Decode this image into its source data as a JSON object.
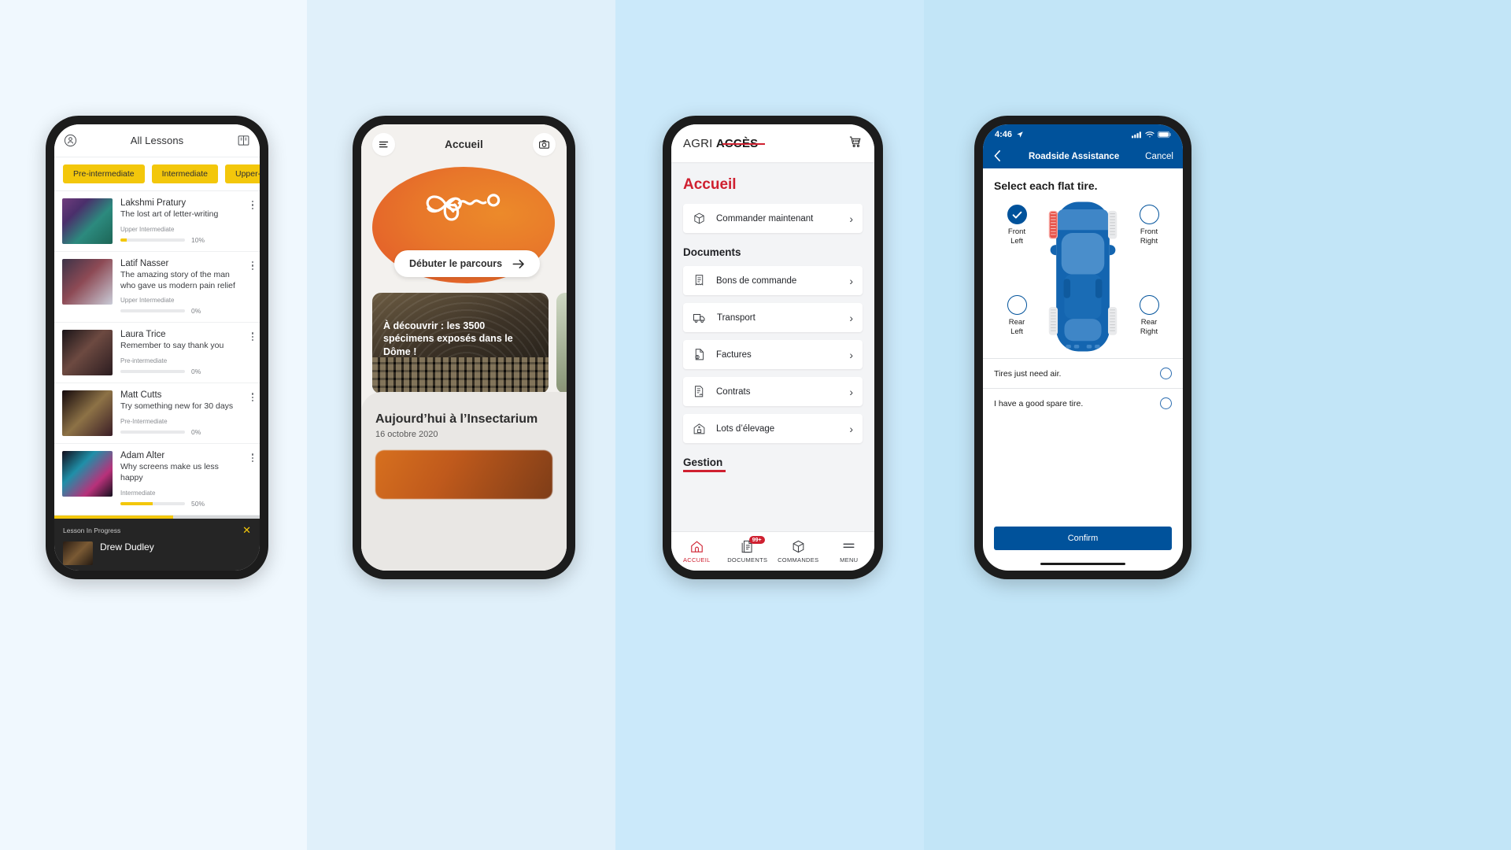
{
  "background": {
    "band_colors": [
      "#f0f8fe",
      "#e0f0fa",
      "#cbe9fa",
      "#c2e5f7"
    ]
  },
  "phone1": {
    "app": "All Lessons",
    "header": {
      "title": "All Lessons",
      "left_icon": "profile-icon",
      "right_icon": "book-icon"
    },
    "chips": [
      "Pre-intermediate",
      "Intermediate",
      "Upper-inte"
    ],
    "lessons": [
      {
        "name": "Lakshmi Pratury",
        "desc": "The lost art of letter-writing",
        "level": "Upper Intermediate",
        "progress": 10,
        "pct": "10%"
      },
      {
        "name": "Latif Nasser",
        "desc": "The amazing story of the man who gave us modern pain relief",
        "level": "Upper Intermediate",
        "progress": 0,
        "pct": "0%"
      },
      {
        "name": "Laura Trice",
        "desc": "Remember to say thank you",
        "level": "Pre-intermediate",
        "progress": 0,
        "pct": "0%"
      },
      {
        "name": "Matt Cutts",
        "desc": "Try something new for 30 days",
        "level": "Pre-Intermediate",
        "progress": 0,
        "pct": "0%"
      },
      {
        "name": "Adam Alter",
        "desc": "Why screens make us less happy",
        "level": "Intermediate",
        "progress": 50,
        "pct": "50%"
      }
    ],
    "banner": {
      "label": "Lesson In Progress",
      "name": "Drew Dudley",
      "close_icon": "close-icon"
    },
    "accent": "#f3c70b"
  },
  "phone2": {
    "header": {
      "title": "Accueil",
      "menu_icon": "hamburger-icon",
      "camera_icon": "camera-icon"
    },
    "cta": {
      "label": "Débuter le parcours",
      "arrow_icon": "arrow-right-icon"
    },
    "cards": [
      {
        "text": "À découvrir : les 3500 spécimens exposés dans le Dôme !"
      },
      {
        "text": ""
      }
    ],
    "section": {
      "title": "Aujourd’hui à l’Insectarium",
      "date": "16 octobre 2020"
    },
    "accent": "#e2562a"
  },
  "phone3": {
    "logo": {
      "part1": "AGRI ",
      "part2": "ACCÈS",
      "strike_color": "#cf2030"
    },
    "cart_icon": "cart-icon",
    "accueil_title": "Accueil",
    "primary_row": {
      "label": "Commander maintenant",
      "icon": "box-icon"
    },
    "documents_title": "Documents",
    "document_rows": [
      {
        "label": "Bons de commande",
        "icon": "receipt-icon"
      },
      {
        "label": "Transport",
        "icon": "truck-icon"
      },
      {
        "label": "Factures",
        "icon": "invoice-icon"
      },
      {
        "label": "Contrats",
        "icon": "contract-icon"
      },
      {
        "label": "Lots d’élevage",
        "icon": "barn-icon"
      }
    ],
    "gestion_title": "Gestion",
    "nav": [
      {
        "label": "ACCUEIL",
        "icon": "home-icon",
        "active": true,
        "badge": ""
      },
      {
        "label": "DOCUMENTS",
        "icon": "documents-icon",
        "active": false,
        "badge": "99+"
      },
      {
        "label": "COMMANDES",
        "icon": "box-icon",
        "active": false,
        "badge": ""
      },
      {
        "label": "MENU",
        "icon": "hamburger-icon",
        "active": false,
        "badge": ""
      }
    ],
    "accent": "#cf2030"
  },
  "phone4": {
    "status": {
      "time": "4:46",
      "location_icon": "location-arrow-icon",
      "signal_icon": "signal-icon",
      "wifi_icon": "wifi-icon",
      "battery_icon": "battery-icon"
    },
    "navbar": {
      "back_icon": "chevron-left-icon",
      "title": "Roadside Assistance",
      "cancel": "Cancel"
    },
    "heading": "Select each flat tire.",
    "tires": [
      {
        "id": "front-left",
        "label": "Front\nLeft",
        "label_line1": "Front",
        "label_line2": "Left",
        "selected": true
      },
      {
        "id": "front-right",
        "label_line1": "Front",
        "label_line2": "Right",
        "selected": false
      },
      {
        "id": "rear-left",
        "label_line1": "Rear",
        "label_line2": "Left",
        "selected": false
      },
      {
        "id": "rear-right",
        "label_line1": "Rear",
        "label_line2": "Right",
        "selected": false
      }
    ],
    "options": [
      {
        "label": "Tires just need air."
      },
      {
        "label": "I have a good spare tire."
      }
    ],
    "confirm_label": "Confirm",
    "accent": "#00529b",
    "flat_tire_color": "#e8534a"
  }
}
